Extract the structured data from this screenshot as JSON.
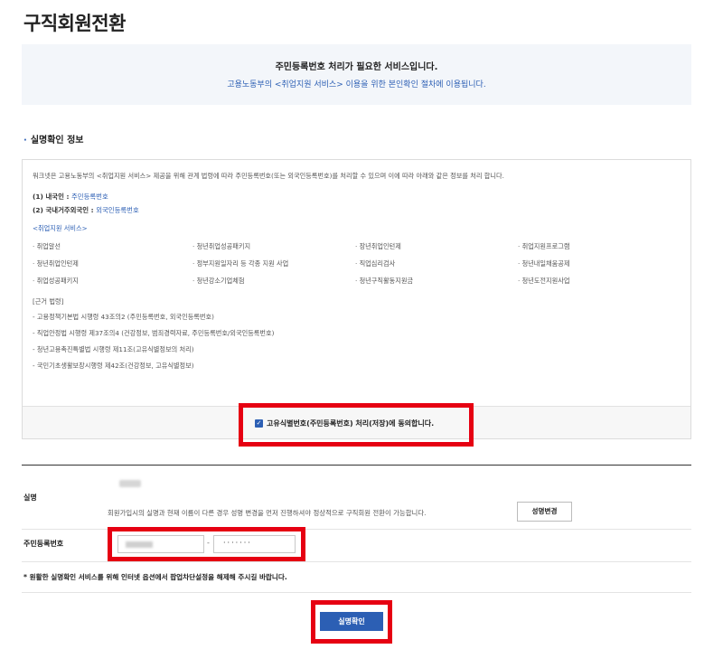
{
  "page": {
    "title": "구직회원전환"
  },
  "notice": {
    "line1": "주민등록번호 처리가 필요한 서비스입니다.",
    "line2": "고용노동부의 <취업지원 서비스> 이용을 위한 본인확인 절차에 이용됩니다."
  },
  "section": {
    "title": "실명확인 정보",
    "bullet": "·"
  },
  "info": {
    "intro": "워크넷은 고용노동부의 <취업지원 서비스> 제공을 위해 관계 법령에 따라 주민등록번호(또는 외국인등록번호)를 처리할 수 있으며 이에 따라 아래와 같은 정보를 처리 합니다.",
    "domestic_label": "(1) 내국인 :",
    "domestic_value": "주민등록번호",
    "foreign_label": "(2) 국내거주외국인 :",
    "foreign_value": "외국인등록번호",
    "services_title": "<취업지원 서비스>",
    "services": [
      "· 취업알선",
      "· 청년취업성공패키지",
      "· 장년취업인턴제",
      "· 취업지원프로그램",
      "· 청년취업인턴제",
      "· 정부지원일자리 등 각종 지원 사업",
      "· 직업심리검사",
      "· 청년내일채움공제",
      "· 취업성공패키지",
      "· 청년강소기업체험",
      "· 청년구직활동지원금",
      "· 청년도전지원사업"
    ],
    "law_title": "[근거 법령]",
    "laws": [
      "- 고용정책기본법 시행령 43조의2 (주민등록번호, 외국인등록번호)",
      "- 직업안정법 시행령 제37조의4 (건강정보, 범죄경력자료, 주민등록번호/외국인등록번호)",
      "- 청년고용촉진특별법 시행령 제11조(고유식별정보의 처리)",
      "- 국민기초생활보장시행령 제42조(건강정보, 고유식별정보)"
    ]
  },
  "agree": {
    "checked": true,
    "label": "고유식별번호(주민등록번호) 처리(저장)에 동의합니다."
  },
  "form": {
    "name_label": "실명",
    "name_help": "회원가입시의 실명과 현재 이름이 다른 경우 성명 변경을 먼저 진행하셔야 정상적으로 구직회원 전환이 가능합니다.",
    "name_change_button": "성명변경",
    "rrn_label": "주민등록번호",
    "rrn_separator": "-",
    "rrn_back_masked": "·······",
    "popup_note": "* 원활한 실명확인 서비스를 위해 인터넷 옵션에서 팝업차단설정을 해제해 주시길 바랍니다.",
    "confirm_button": "실명확인"
  },
  "colors": {
    "accent": "#2c5fb4",
    "highlight": "#e60012",
    "notice_bg": "#f3f6fa"
  },
  "icons": {
    "checkbox": "checkbox-checked-icon"
  }
}
